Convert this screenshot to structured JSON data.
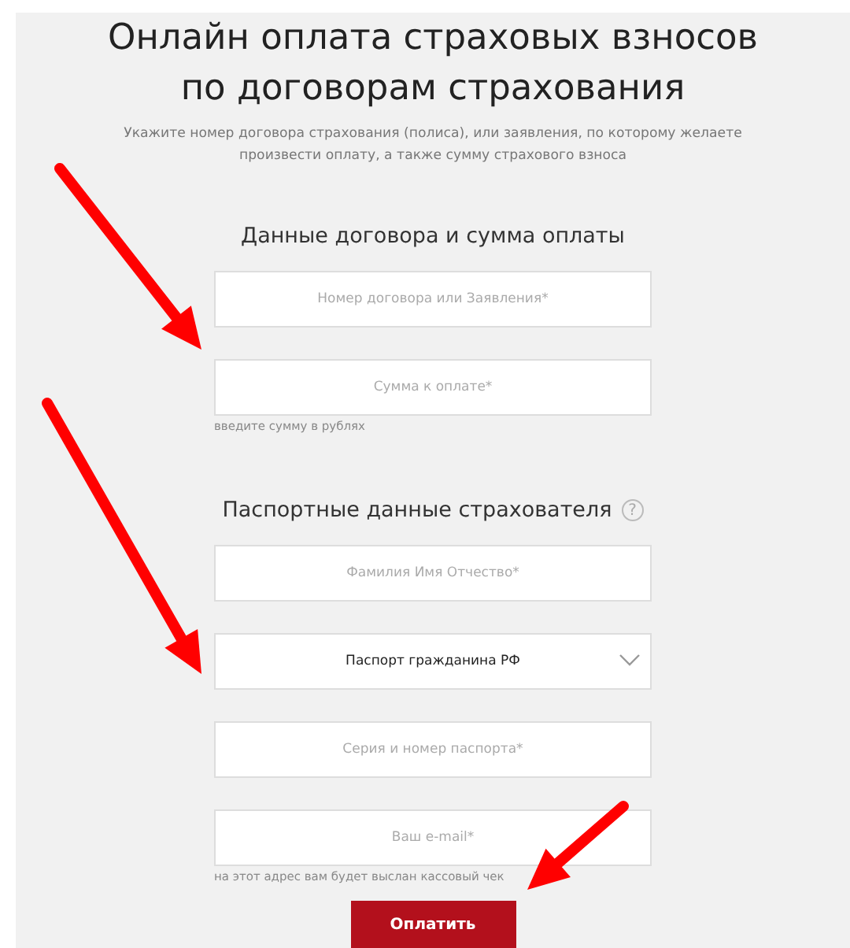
{
  "title_lines": [
    "Онлайн оплата страховых взносов",
    "по договорам страхования"
  ],
  "intro": "Укажите номер договора страхования (полиса), или заявления, по которому желаете произвести оплату, а также сумму страхового взноса",
  "sections": [
    {
      "heading": "Данные договора и сумма оплаты",
      "fields": [
        {
          "kind": "input",
          "placeholder": "Номер договора или Заявления*"
        },
        {
          "kind": "input",
          "placeholder": "Сумма к оплате*",
          "hint": "введите сумму в рублях"
        }
      ]
    },
    {
      "heading": "Паспортные данные страхователя",
      "help": "?",
      "fields": [
        {
          "kind": "input",
          "placeholder": "Фамилия Имя Отчество*"
        },
        {
          "kind": "select",
          "value": "Паспорт гражданина РФ"
        },
        {
          "kind": "input",
          "placeholder": "Серия и номер паспорта*"
        },
        {
          "kind": "input",
          "placeholder": "Ваш e-mail*",
          "hint": "на этот адрес вам будет выслан кассовый чек"
        }
      ]
    }
  ],
  "submit": "Оплатить"
}
